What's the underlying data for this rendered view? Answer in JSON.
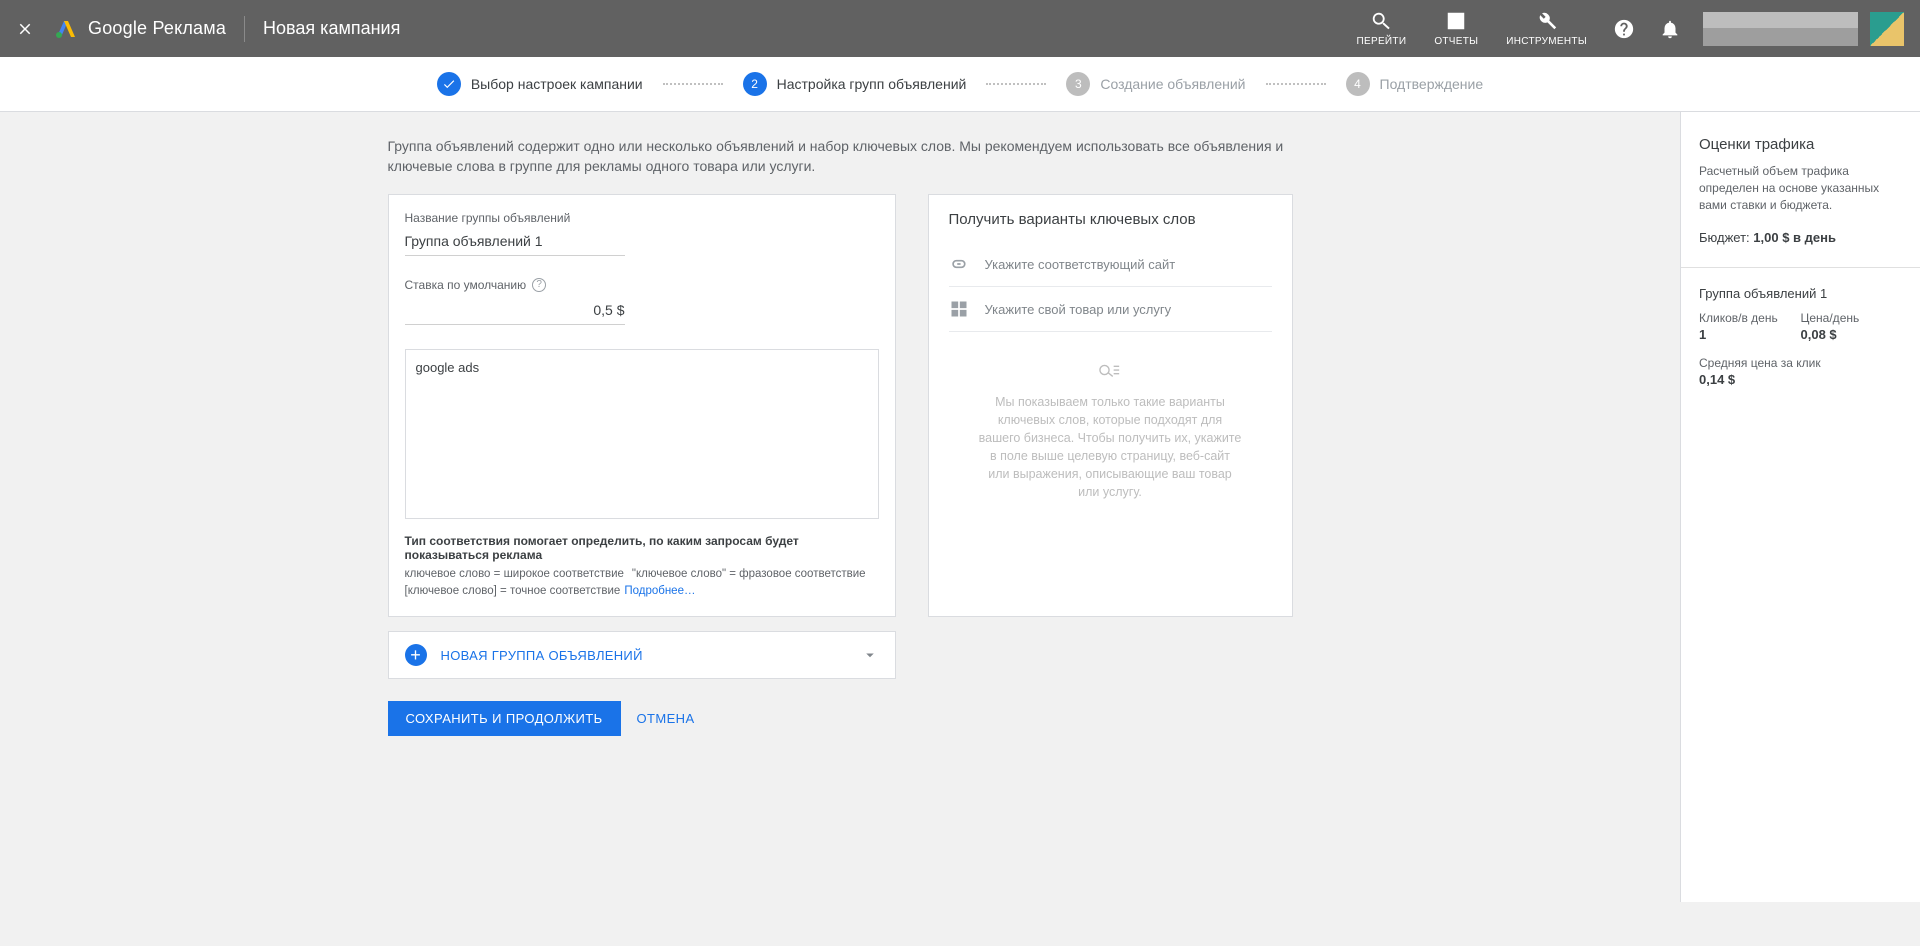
{
  "header": {
    "product_name": "Google Реклама",
    "campaign_name": "Новая кампания",
    "tools": {
      "go": "ПЕРЕЙТИ",
      "reports": "ОТЧЕТЫ",
      "tools": "ИНСТРУМЕНТЫ"
    }
  },
  "steps": [
    {
      "label": "Выбор настроек кампании"
    },
    {
      "num": "2",
      "label": "Настройка групп объявлений"
    },
    {
      "num": "3",
      "label": "Создание объявлений"
    },
    {
      "num": "4",
      "label": "Подтверждение"
    }
  ],
  "intro": "Группа объявлений содержит одно или несколько объявлений и набор ключевых слов. Мы рекомендуем использовать все объявления и ключевые слова в группе для рекламы одного товара или услуги.",
  "adgroup": {
    "name_label": "Название группы объявлений",
    "name_value": "Группа объявлений 1",
    "bid_label": "Ставка по умолчанию",
    "bid_value": "0,5 $",
    "keywords_value": "google ads",
    "match_title": "Тип соответствия помогает определить, по каким запросам будет показываться реклама",
    "match_line1a": "ключевое слово = широкое соответствие",
    "match_line1b": "\"ключевое слово\" = фразовое соответствие",
    "match_line2": "[ключевое слово] = точное соответствие",
    "learn_more": "Подробнее…"
  },
  "suggest": {
    "title": "Получить варианты ключевых слов",
    "site_placeholder": "Укажите соответствующий сайт",
    "product_placeholder": "Укажите свой товар или услугу",
    "empty_text": "Мы показываем только такие варианты ключевых слов, которые подходят для вашего бизнеса. Чтобы получить их, укажите в поле выше целевую страницу, веб-сайт или выражения, описывающие ваш товар или услугу."
  },
  "new_group": "НОВАЯ ГРУППА ОБЪЯВЛЕНИЙ",
  "footer": {
    "save": "СОХРАНИТЬ И ПРОДОЛЖИТЬ",
    "cancel": "ОТМЕНА"
  },
  "side": {
    "title": "Оценки трафика",
    "desc": "Расчетный объем трафика определен на основе указанных вами ставки и бюджета.",
    "budget_label": "Бюджет:",
    "budget_value": "1,00 $ в день",
    "group_title": "Группа объявлений 1",
    "clicks_label": "Кликов/в день",
    "clicks_value": "1",
    "price_label": "Цена/день",
    "price_value": "0,08 $",
    "avg_label": "Средняя цена за клик",
    "avg_value": "0,14 $"
  }
}
